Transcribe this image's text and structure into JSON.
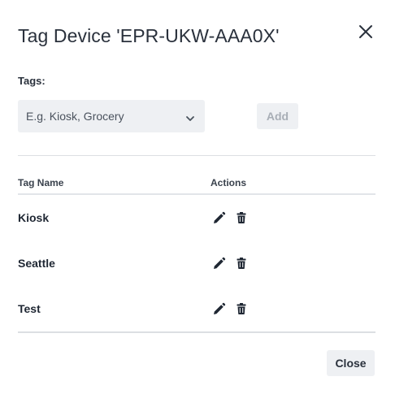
{
  "dialog": {
    "title": "Tag Device 'EPR-UKW-AAA0X'",
    "close_icon": "close-icon"
  },
  "form": {
    "tags_label": "Tags:",
    "select_placeholder": "E.g. Kiosk, Grocery",
    "add_label": "Add"
  },
  "table": {
    "headers": {
      "name": "Tag Name",
      "actions": "Actions"
    },
    "rows": [
      {
        "name": "Kiosk"
      },
      {
        "name": "Seattle"
      },
      {
        "name": "Test"
      }
    ],
    "icons": {
      "edit": "pencil-icon",
      "delete": "trash-icon"
    }
  },
  "footer": {
    "close_label": "Close"
  },
  "colors": {
    "text": "#1f2733",
    "input_bg": "#eef0f3",
    "disabled_text": "#a8aeb6",
    "divider": "#dcdfe3"
  }
}
